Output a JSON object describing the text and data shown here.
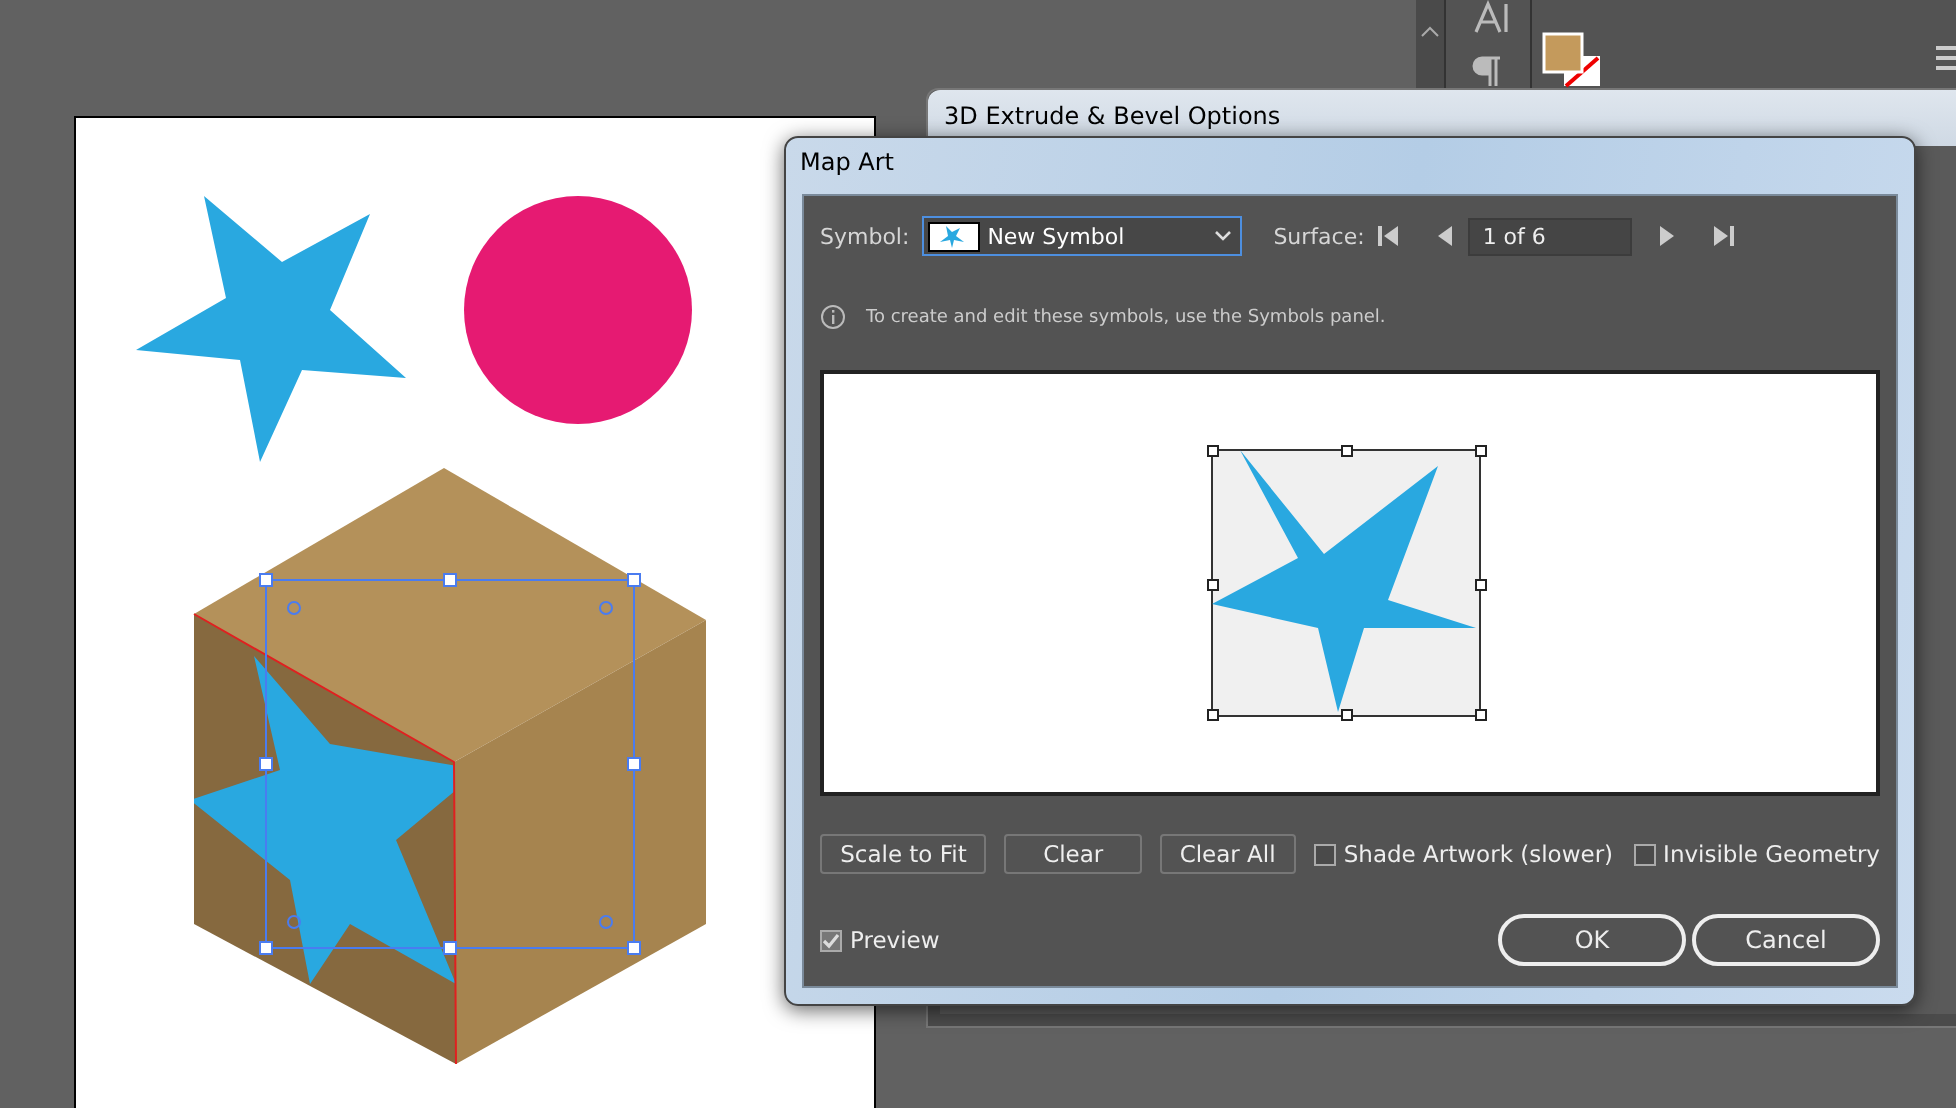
{
  "back_window": {
    "title": "3D Extrude & Bevel Options"
  },
  "dialog": {
    "title": "Map Art",
    "symbol_label": "Symbol:",
    "symbol_value": "New Symbol",
    "surface_label": "Surface:",
    "surface_value": "1 of 6",
    "info": "To create and edit these symbols, use the Symbols panel.",
    "buttons": [
      "Scale to Fit",
      "Clear",
      "Clear All"
    ],
    "options": [
      {
        "label": "Shade Artwork (slower)",
        "checked": false
      },
      {
        "label": "Invisible Geometry",
        "checked": false
      }
    ],
    "preview": {
      "label": "Preview",
      "checked": true
    },
    "ok": "OK",
    "cancel": "Cancel"
  }
}
